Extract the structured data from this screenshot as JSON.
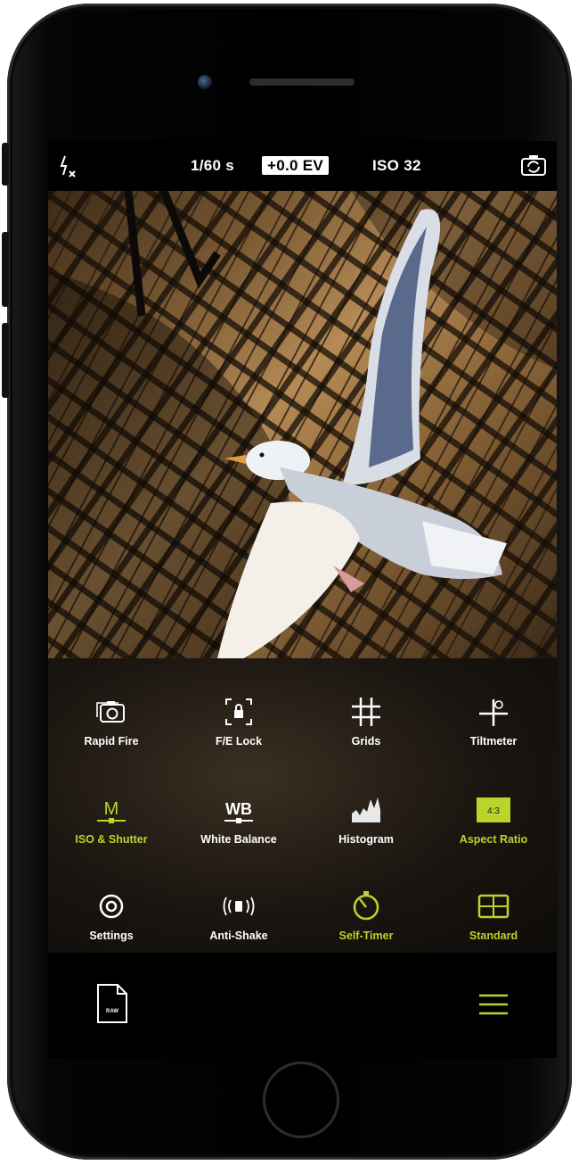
{
  "topbar": {
    "flash_icon": "flash-off-icon",
    "shutter": "1/60 s",
    "ev": "+0.0 EV",
    "iso": "ISO 32",
    "switch_camera_icon": "camera-switch-icon"
  },
  "tools": [
    {
      "label": "Rapid Fire",
      "icon": "rapid-fire-icon",
      "active": false
    },
    {
      "label": "F/E Lock",
      "icon": "fe-lock-icon",
      "active": false
    },
    {
      "label": "Grids",
      "icon": "grid-icon",
      "active": false
    },
    {
      "label": "Tiltmeter",
      "icon": "tiltmeter-icon",
      "active": false
    },
    {
      "label": "ISO & Shutter",
      "icon": "manual-mode-icon",
      "icon_text": "M",
      "active": true
    },
    {
      "label": "White Balance",
      "icon": "white-balance-icon",
      "icon_text": "WB",
      "active": false
    },
    {
      "label": "Histogram",
      "icon": "histogram-icon",
      "active": false
    },
    {
      "label": "Aspect Ratio",
      "icon": "aspect-ratio-icon",
      "icon_text": "4:3",
      "active": true
    },
    {
      "label": "Settings",
      "icon": "settings-icon",
      "active": false
    },
    {
      "label": "Anti-Shake",
      "icon": "anti-shake-icon",
      "active": false
    },
    {
      "label": "Self-Timer",
      "icon": "self-timer-icon",
      "active": true
    },
    {
      "label": "Standard",
      "icon": "standard-layout-icon",
      "active": true
    }
  ],
  "bottombar": {
    "raw_label": "RAW",
    "raw_icon": "raw-file-icon",
    "menu_icon": "menu-icon"
  },
  "colors": {
    "accent": "#b9d42a",
    "text": "#ffffff",
    "background": "#000000"
  }
}
